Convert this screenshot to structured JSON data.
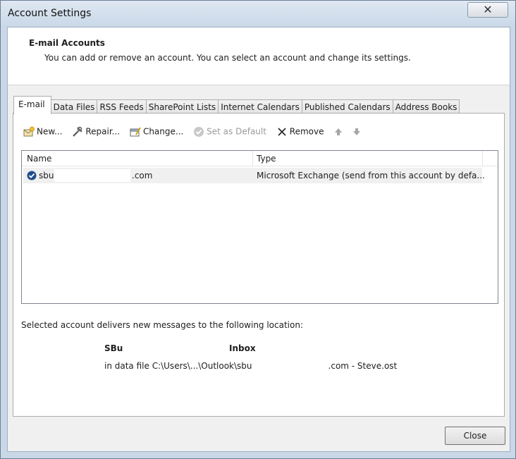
{
  "window": {
    "title": "Account Settings",
    "close_glyph": "✕"
  },
  "header": {
    "title": "E-mail Accounts",
    "description": "You can add or remove an account. You can select an account and change its settings."
  },
  "tabs": [
    {
      "label": "E-mail",
      "active": true
    },
    {
      "label": "Data Files"
    },
    {
      "label": "RSS Feeds"
    },
    {
      "label": "SharePoint Lists"
    },
    {
      "label": "Internet Calendars"
    },
    {
      "label": "Published Calendars"
    },
    {
      "label": "Address Books"
    }
  ],
  "toolbar": {
    "new_label": "New...",
    "repair_label": "Repair...",
    "change_label": "Change...",
    "set_default_label": "Set as Default",
    "remove_label": "Remove",
    "icons": [
      "new-account-icon",
      "repair-icon",
      "change-icon",
      "checkmark-icon",
      "remove-x-icon",
      "move-up-arrow-icon",
      "move-down-arrow-icon"
    ]
  },
  "accounts_list": {
    "columns": [
      "Name",
      "Type"
    ],
    "rows": [
      {
        "name_prefix": "sbu",
        "name_suffix": ".com",
        "type": "Microsoft Exchange (send from this account by defa..."
      }
    ]
  },
  "delivery": {
    "label": "Selected account delivers new messages to the following location:",
    "mailbox": "SBu",
    "folder": "Inbox",
    "file_prefix": "in data file C:\\Users\\...\\Outlook\\sbu",
    "file_suffix": ".com - Steve.ost"
  },
  "footer": {
    "close_label": "Close"
  },
  "colors": {
    "window_frame": "#c9d7e6",
    "panel_bg": "#f0f0f0",
    "selected_row": "#f0f0f0",
    "default_badge": "#1f4e8c"
  }
}
